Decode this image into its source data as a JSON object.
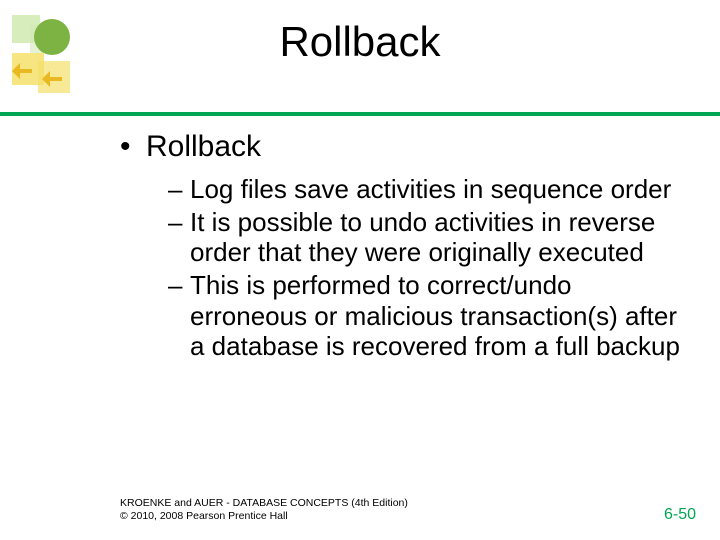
{
  "title": "Rollback",
  "main_bullet": "Rollback",
  "sub_bullets": [
    "Log files save activities in sequence order",
    "It is possible to undo activities in reverse order that they were originally executed",
    "This is performed to correct/undo erroneous or malicious transaction(s) after a database is recovered from a full backup"
  ],
  "footer_source": "KROENKE and AUER - DATABASE CONCEPTS (4th Edition)",
  "footer_copyright": "© 2010, 2008 Pearson Prentice Hall",
  "slide_number": "6-50",
  "colors": {
    "accent": "#00a651"
  }
}
